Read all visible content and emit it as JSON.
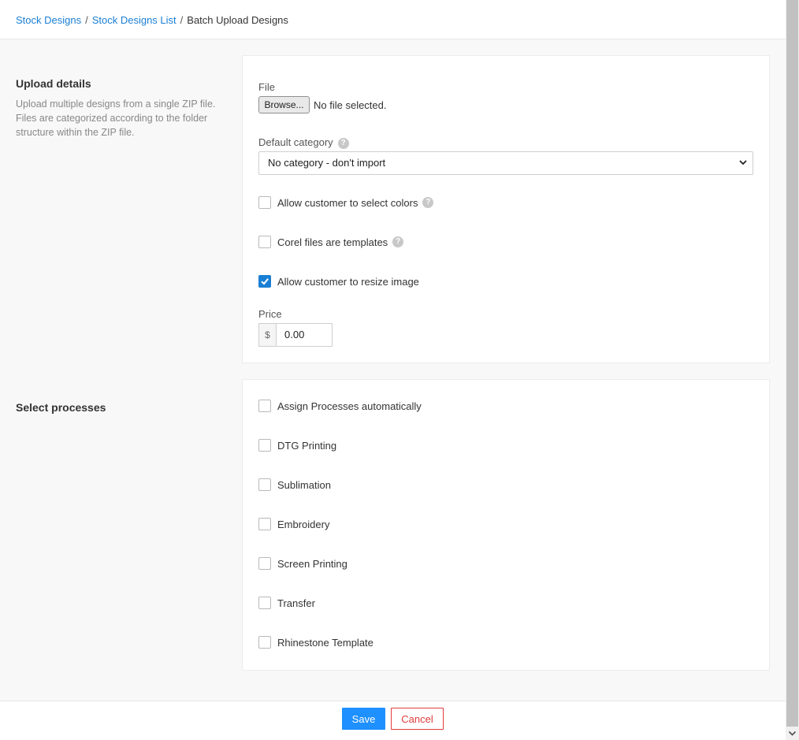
{
  "breadcrumb": {
    "items": [
      "Stock Designs",
      "Stock Designs List"
    ],
    "separator": "/",
    "current": "Batch Upload Designs"
  },
  "upload_section": {
    "title": "Upload details",
    "description": "Upload multiple designs from a single ZIP file. Files are categorized according to the folder structure within the ZIP file."
  },
  "upload_form": {
    "file_label": "File",
    "browse_label": "Browse...",
    "file_status": "No file selected.",
    "category_label": "Default category",
    "category_value": "No category - don't import",
    "allow_colors_label": "Allow customer to select colors",
    "allow_colors_checked": false,
    "corel_label": "Corel files are templates",
    "corel_checked": false,
    "resize_label": "Allow customer to resize image",
    "resize_checked": true,
    "price_label": "Price",
    "currency_symbol": "$",
    "price_value": "0.00",
    "help_glyph": "?"
  },
  "processes_section": {
    "title": "Select processes",
    "items": [
      {
        "label": "Assign Processes automatically",
        "checked": false
      },
      {
        "label": "DTG Printing",
        "checked": false
      },
      {
        "label": "Sublimation",
        "checked": false
      },
      {
        "label": "Embroidery",
        "checked": false
      },
      {
        "label": "Screen Printing",
        "checked": false
      },
      {
        "label": "Transfer",
        "checked": false
      },
      {
        "label": "Rhinestone Template",
        "checked": false
      }
    ]
  },
  "footer": {
    "save_label": "Save",
    "cancel_label": "Cancel"
  },
  "colors": {
    "link": "#1a7fd4",
    "primary_button": "#1e90ff",
    "cancel": "#e03c3c",
    "checked": "#1a7fd4"
  },
  "icons": {
    "help": "question-circle-icon",
    "select_arrow": "chevron-down-icon",
    "checkmark": "check-icon",
    "scroll_down": "scroll-down-arrow-icon"
  }
}
